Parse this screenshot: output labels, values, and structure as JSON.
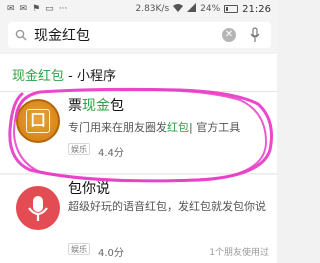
{
  "status_bar": {
    "left_icons": [
      "✉",
      "✉",
      "⚑",
      "▭",
      "···"
    ],
    "network_speed": "2.83K/s",
    "battery": "24%",
    "battery_level": 0.24,
    "time": "21:26"
  },
  "search": {
    "query": "现金红包"
  },
  "section": {
    "title_highlight": "现金红包",
    "title_rest": " - 小程序"
  },
  "results": [
    {
      "name_prefix": "票",
      "name_highlight": "现金",
      "name_suffix": "包",
      "icon_glyph": "囗",
      "desc_prefix": "专门用来在朋友圈发",
      "desc_highlight": "红包",
      "desc_suffix": "| 官方工具",
      "tag": "娱乐",
      "rating": "4.4分"
    },
    {
      "name": "包你说",
      "desc_line": "超级好玩的语音红包，发红包就发包你说",
      "tag": "娱乐",
      "rating": "4.0分",
      "users": "1个朋友使用过"
    }
  ],
  "colors": {
    "highlight": "#2ba245",
    "annotation": "#e83fc7",
    "icon1": "#d8871a",
    "icon2": "#e24c52"
  }
}
